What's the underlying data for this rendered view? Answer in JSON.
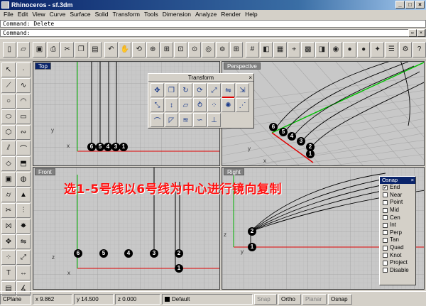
{
  "window": {
    "title": "Rhinoceros - sf.3dm",
    "min": "_",
    "max": "□",
    "close": "×"
  },
  "menu": [
    "File",
    "Edit",
    "View",
    "Curve",
    "Surface",
    "Solid",
    "Transform",
    "Tools",
    "Dimension",
    "Analyze",
    "Render",
    "Help"
  ],
  "command": {
    "history": "Command: Delete",
    "prompt": "Command:"
  },
  "toolbar_icons": [
    "new-file-icon",
    "open-file-icon",
    "save-icon",
    "print-icon",
    "cut-icon",
    "copy-icon",
    "paste-icon",
    "undo-icon",
    "pan-icon",
    "rotate-view-icon",
    "zoom-dynamic-icon",
    "zoom-window-icon",
    "zoom-extents-icon",
    "zoom-selected-icon",
    "zoom-target-icon",
    "zoom-all-icon",
    "four-view-icon",
    "grid-icon",
    "layer-icon",
    "select-color-icon",
    "osnap-icon",
    "render-icon",
    "render-preview-icon",
    "color-wheel-icon",
    "material-icon",
    "sphere-icon",
    "light-icon",
    "properties-icon",
    "options-icon",
    "help-icon"
  ],
  "left_tools": [
    "select-icon",
    "point-icon",
    "polyline-icon",
    "curve-icon",
    "circle-icon",
    "arc-icon",
    "ellipse-icon",
    "rectangle-icon",
    "polygon-icon",
    "freeform-icon",
    "offset-icon",
    "fillet-icon",
    "surface-icon",
    "extrude-icon",
    "box-icon",
    "sphere-solid-icon",
    "cylinder-icon",
    "cone-icon",
    "trim-icon",
    "split-icon",
    "join-icon",
    "explode-icon",
    "move-icon",
    "mirror-icon",
    "array-icon",
    "scale-icon",
    "text-icon",
    "dimension-icon",
    "layout-icon",
    "analyze-icon"
  ],
  "viewports": {
    "top": {
      "label": "Top",
      "numbers": [
        "6",
        "5",
        "4",
        "3",
        "1"
      ],
      "axis_x": "x",
      "axis_y": "y"
    },
    "perspective": {
      "label": "Perspective",
      "numbers": [
        "6",
        "5",
        "4",
        "3",
        "2",
        "1"
      ],
      "axis_x": "x",
      "axis_y": "y"
    },
    "front": {
      "label": "Front",
      "numbers": [
        "6",
        "5",
        "4",
        "3",
        "2",
        "1"
      ],
      "axis_x": "x",
      "axis_z": "z"
    },
    "right": {
      "label": "Right",
      "numbers": [
        "2",
        "1"
      ],
      "axis_y": "y",
      "axis_z": "z"
    }
  },
  "transform_toolbar": {
    "title": "Transform",
    "close": "×",
    "buttons": [
      "move-icon",
      "copy-icon",
      "rotate-icon",
      "rotate-3d-icon",
      "scale-icon",
      "mirror-icon",
      "orient-icon",
      "scale-2d-icon",
      "scale-1d-icon",
      "shear-icon",
      "twist-icon",
      "array-icon",
      "array-polar-icon",
      "array-curve-icon",
      "bend-icon",
      "taper-icon",
      "flow-icon",
      "smooth-icon",
      "project-icon"
    ]
  },
  "annotation": "选1-5号线以6号线为中心进行镜向复制",
  "osnap": {
    "title": "Osnap",
    "close": "×",
    "items": [
      {
        "label": "End",
        "checked": true
      },
      {
        "label": "Near",
        "checked": false
      },
      {
        "label": "Point",
        "checked": false
      },
      {
        "label": "Mid",
        "checked": false
      },
      {
        "label": "Cen",
        "checked": false
      },
      {
        "label": "Int",
        "checked": false
      },
      {
        "label": "Perp",
        "checked": false
      },
      {
        "label": "Tan",
        "checked": false
      },
      {
        "label": "Quad",
        "checked": false
      },
      {
        "label": "Knot",
        "checked": false
      },
      {
        "label": "Project",
        "checked": false
      },
      {
        "label": "Disable",
        "checked": false
      }
    ]
  },
  "status": {
    "cplane": "CPlane",
    "x": "x 9.862",
    "y": "y 14.500",
    "z": "z 0.000",
    "layer": "Default",
    "snap": "Snap",
    "ortho": "Ortho",
    "planar": "Planar",
    "osnap": "Osnap"
  },
  "colors": {
    "title_bar": "#0a246a",
    "x_axis": "#e00000",
    "y_axis": "#00c000",
    "annotation": "#ff1010"
  }
}
